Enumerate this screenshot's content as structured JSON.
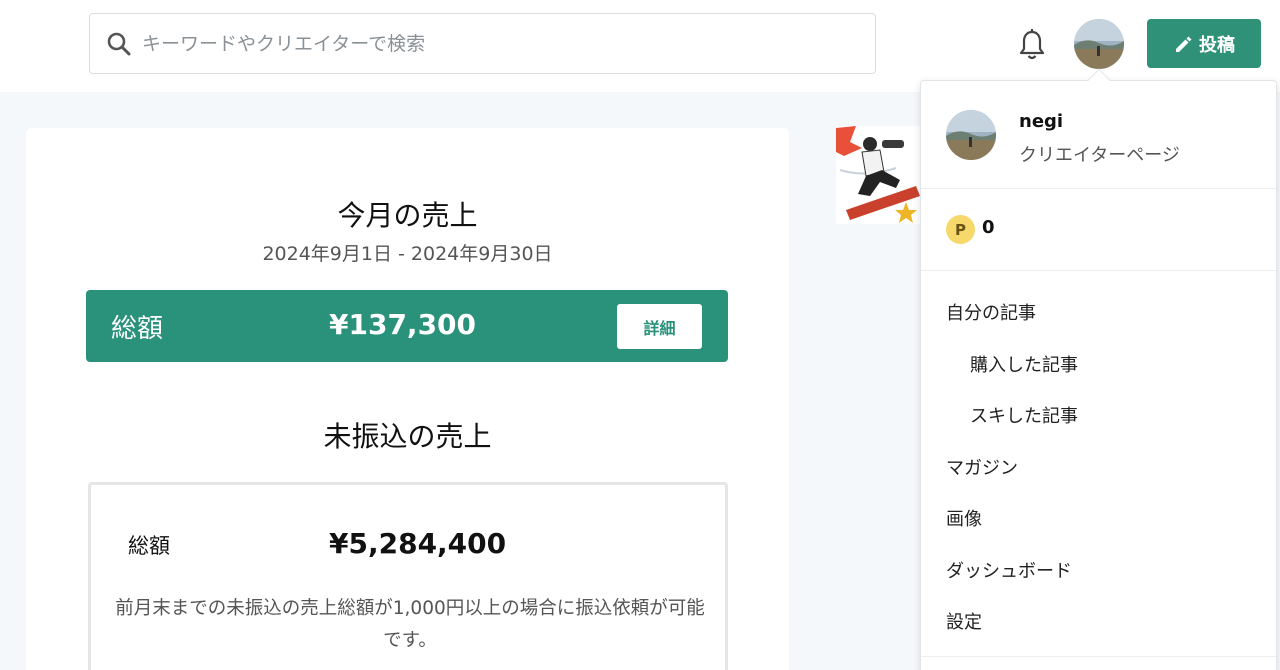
{
  "header": {
    "search_placeholder": "キーワードやクリエイターで検索",
    "post_label": "投稿"
  },
  "monthly": {
    "title": "今月の売上",
    "date_range": "2024年9月1日 - 2024年9月30日",
    "total_label": "総額",
    "total_amount": "¥137,300",
    "detail_label": "詳細"
  },
  "unpaid": {
    "title": "未振込の売上",
    "total_label": "総額",
    "total_amount": "¥5,284,400",
    "note": "前月末までの未振込の売上総額が1,000円以上の場合に振込依頼が可能です。"
  },
  "dropdown": {
    "user_name": "negi",
    "user_sub": "クリエイターページ",
    "points_icon": "P",
    "points": "0",
    "items": [
      {
        "label": "自分の記事"
      },
      {
        "label": "購入した記事"
      },
      {
        "label": "スキした記事"
      },
      {
        "label": "マガジン"
      },
      {
        "label": "画像"
      },
      {
        "label": "ダッシュボード"
      },
      {
        "label": "設定"
      }
    ]
  },
  "colors": {
    "accent": "#2a917a",
    "post_button": "#2e9178",
    "page_bg": "#f5f8fa",
    "coin": "#f7d86a"
  },
  "icons": [
    "search-icon",
    "bell-icon",
    "pencil-icon",
    "avatar",
    "point-coin-icon"
  ]
}
